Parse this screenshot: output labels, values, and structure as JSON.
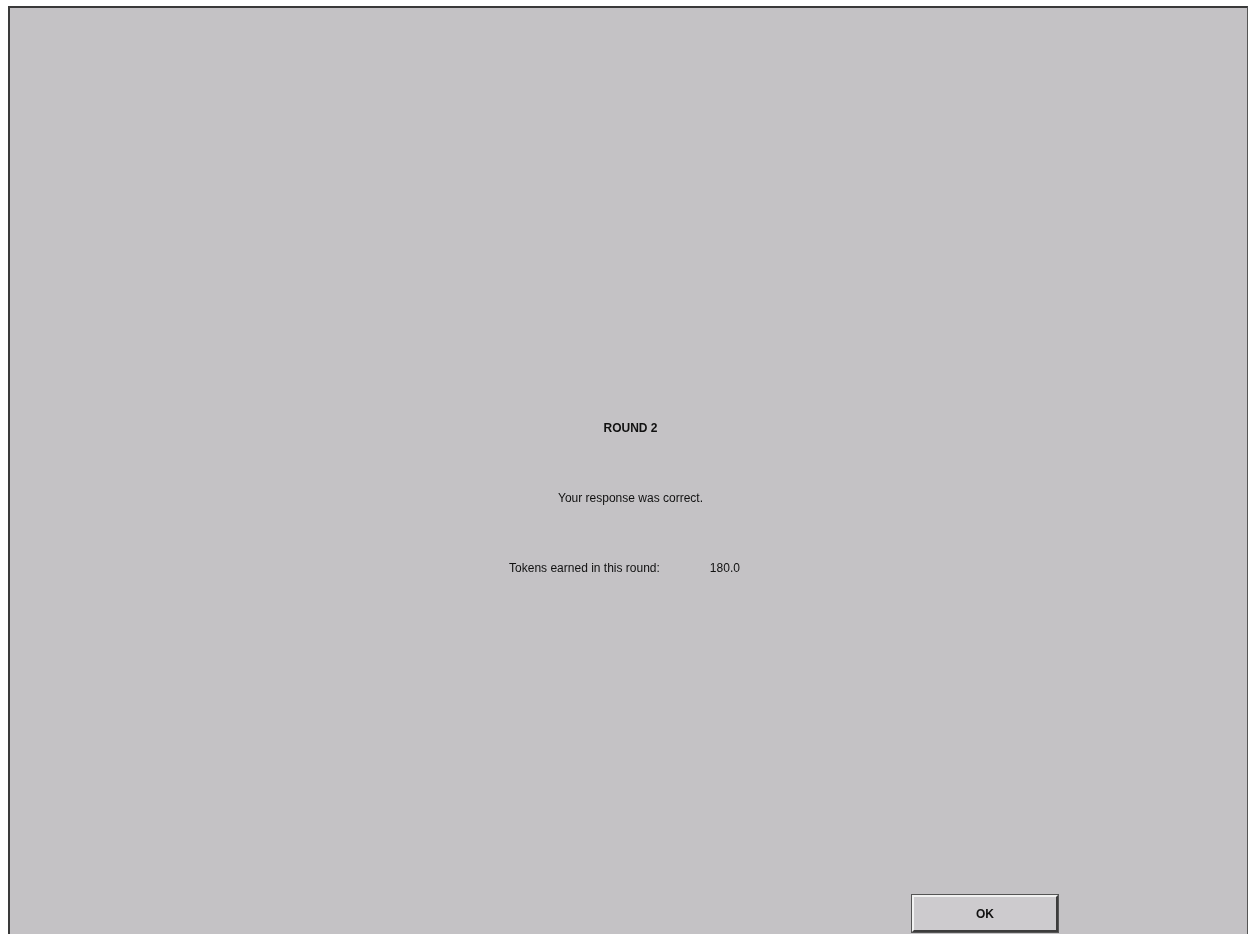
{
  "title": "ROUND 2",
  "message": "Your response was correct.",
  "tokens": {
    "label": "Tokens earned in this round:",
    "value": "180.0"
  },
  "buttons": [
    "OK"
  ]
}
